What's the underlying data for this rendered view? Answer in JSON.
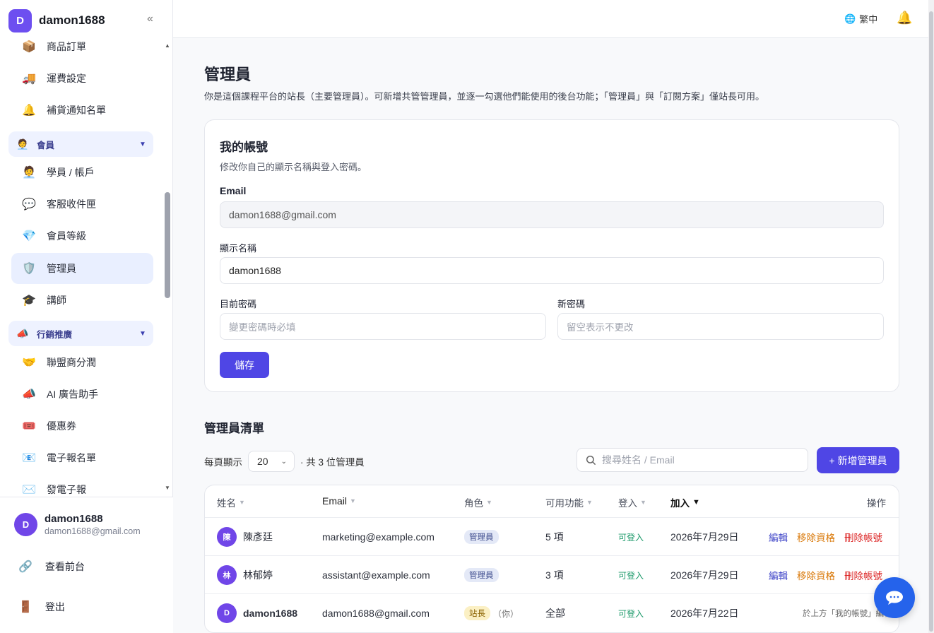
{
  "brand": {
    "logo_letter": "D",
    "name": "damon1688",
    "collapse_icon": "«"
  },
  "sidebar": {
    "items": [
      {
        "icon": "📦",
        "label": "商品訂單"
      },
      {
        "icon": "🚚",
        "label": "運費設定"
      },
      {
        "icon": "🔔",
        "label": "補貨通知名單"
      },
      {
        "icon": "🧑‍💼",
        "label": "會員",
        "group": true
      },
      {
        "icon": "🧑‍💼",
        "label": "學員 / 帳戶"
      },
      {
        "icon": "💬",
        "label": "客服收件匣"
      },
      {
        "icon": "💎",
        "label": "會員等級"
      },
      {
        "icon": "🛡️",
        "label": "管理員",
        "active": true
      },
      {
        "icon": "🎓",
        "label": "講師"
      },
      {
        "icon": "📣",
        "label": "行銷推廣",
        "group": true
      },
      {
        "icon": "🤝",
        "label": "聯盟商分潤"
      },
      {
        "icon": "📣",
        "label": "AI 廣告助手"
      },
      {
        "icon": "🎟️",
        "label": "優惠券"
      },
      {
        "icon": "📧",
        "label": "電子報名單"
      },
      {
        "icon": "✉️",
        "label": "發電子報"
      }
    ],
    "scroll_up": "▲",
    "scroll_down": "▼"
  },
  "footer": {
    "avatar_letter": "D",
    "user_name": "damon1688",
    "user_email": "damon1688@gmail.com",
    "view_front": "查看前台",
    "logout": "登出"
  },
  "topbar": {
    "lang_label": "繁中"
  },
  "page": {
    "title": "管理員",
    "description": "你是這個課程平台的站長（主要管理員）。可新增共管管理員，並逐一勾選他們能使用的後台功能；「管理員」與「訂閱方案」僅站長可用。"
  },
  "account": {
    "title": "我的帳號",
    "subtitle": "修改你自己的顯示名稱與登入密碼。",
    "email_label": "Email",
    "email_value": "damon1688@gmail.com",
    "display_label": "顯示名稱",
    "display_value": "damon1688",
    "current_pw_label": "目前密碼",
    "current_pw_placeholder": "變更密碼時必填",
    "new_pw_label": "新密碼",
    "new_pw_placeholder": "留空表示不更改",
    "save_label": "儲存"
  },
  "admin_list": {
    "title": "管理員清單",
    "per_page_label": "每頁顯示",
    "per_page_value": "20",
    "count_text": "· 共 3 位管理員",
    "search_placeholder": "搜尋姓名 / Email",
    "add_label": "+ 新增管理員",
    "columns": [
      "姓名",
      "Email",
      "角色",
      "可用功能",
      "登入",
      "加入",
      "操作"
    ],
    "sort_icon": "▼",
    "rows": [
      {
        "avatar": "陳",
        "name": "陳彥廷",
        "email": "marketing@example.com",
        "role": "管理員",
        "features": "5 項",
        "login": "可登入",
        "joined": "2026年7月29日",
        "edit": "編輯",
        "remove": "移除資格",
        "delete": "刪除帳號"
      },
      {
        "avatar": "林",
        "name": "林郁婷",
        "email": "assistant@example.com",
        "role": "管理員",
        "features": "3 項",
        "login": "可登入",
        "joined": "2026年7月29日",
        "edit": "編輯",
        "remove": "移除資格",
        "delete": "刪除帳號"
      },
      {
        "avatar": "D",
        "name": "damon1688",
        "email": "damon1688@gmail.com",
        "role": "站長",
        "you": "（你）",
        "features": "全部",
        "login": "可登入",
        "joined": "2026年7月22日",
        "note": "於上方「我的帳號」編輯"
      }
    ]
  },
  "colors": {
    "accent": "#4f46e5",
    "avatar": "#7046e8",
    "active_bg": "#e9efff",
    "edit": "#4046c8",
    "remove": "#d97706",
    "delete": "#dc2626",
    "login_ok": "#1c9a6a",
    "chat": "#2563eb"
  }
}
